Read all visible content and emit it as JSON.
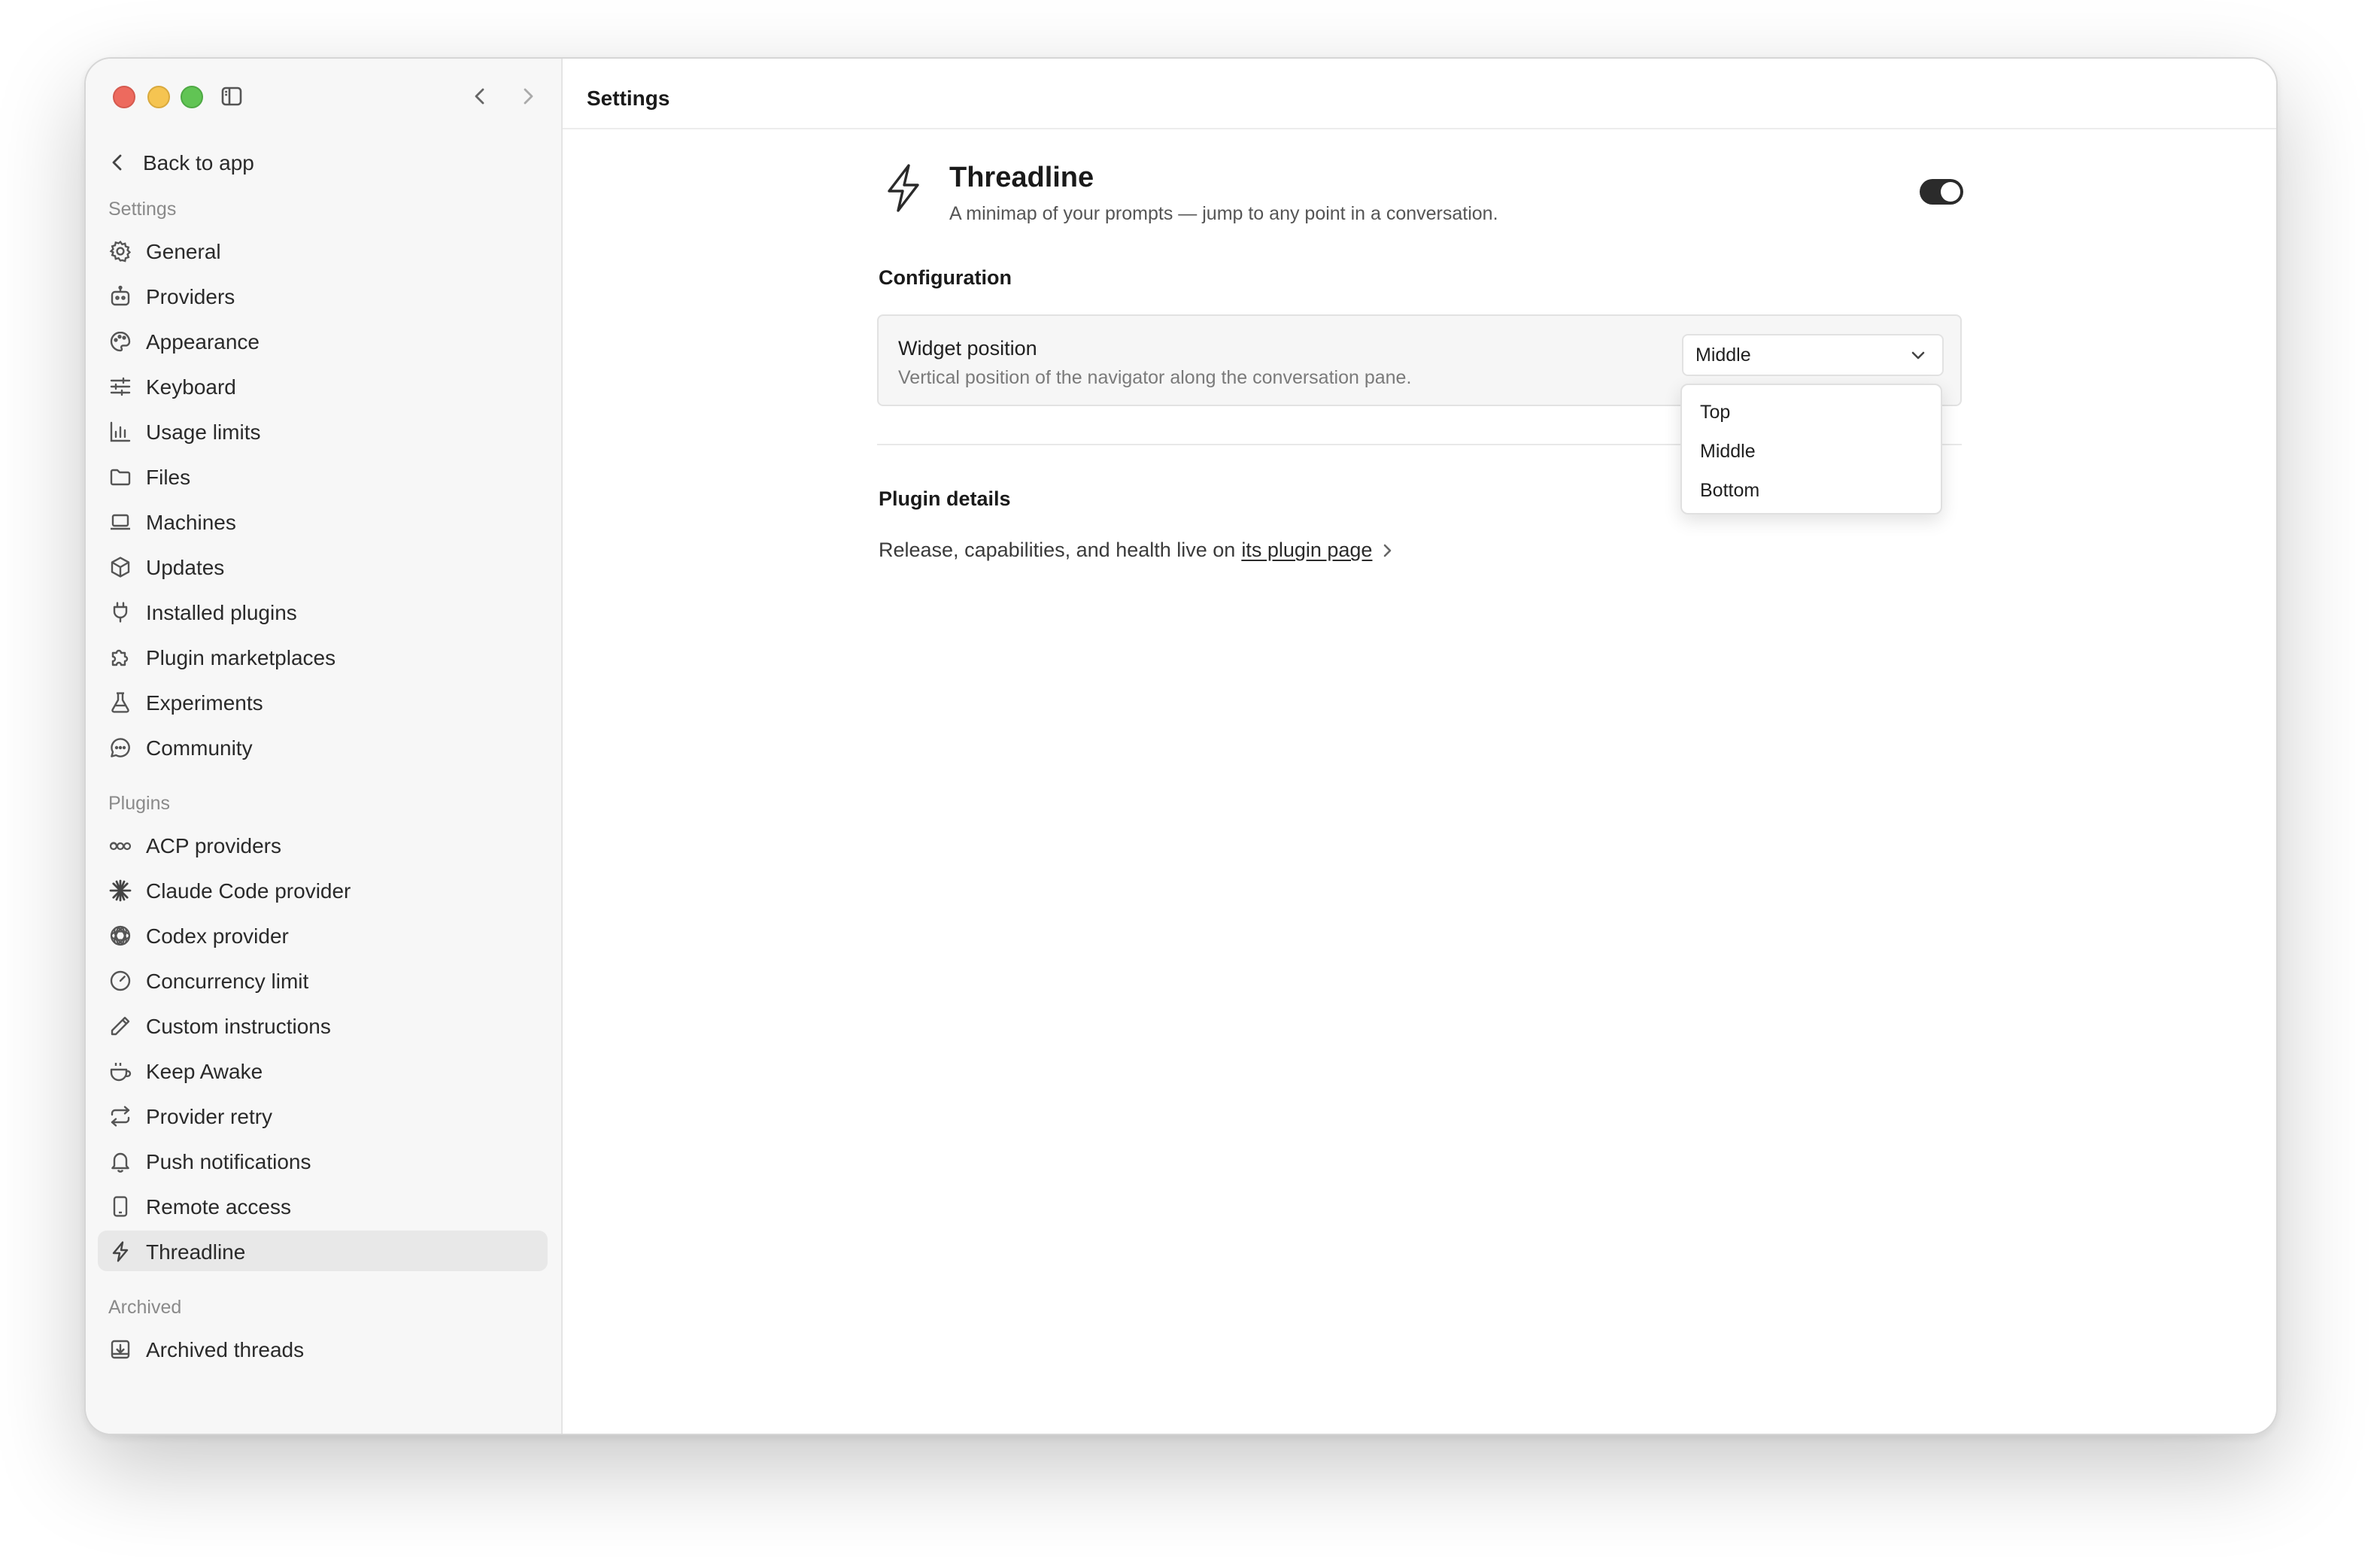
{
  "sidebar": {
    "back_label": "Back to app",
    "settings_heading": "Settings",
    "settings_items": [
      {
        "label": "General",
        "icon": "gear-icon"
      },
      {
        "label": "Providers",
        "icon": "bot-icon"
      },
      {
        "label": "Appearance",
        "icon": "palette-icon"
      },
      {
        "label": "Keyboard",
        "icon": "sliders-icon"
      },
      {
        "label": "Usage limits",
        "icon": "bar-chart-icon"
      },
      {
        "label": "Files",
        "icon": "folder-icon"
      },
      {
        "label": "Machines",
        "icon": "laptop-icon"
      },
      {
        "label": "Updates",
        "icon": "package-icon"
      },
      {
        "label": "Installed plugins",
        "icon": "plug-icon"
      },
      {
        "label": "Plugin marketplaces",
        "icon": "puzzle-icon"
      },
      {
        "label": "Experiments",
        "icon": "flask-icon"
      },
      {
        "label": "Community",
        "icon": "chat-bubble-icon"
      }
    ],
    "plugins_heading": "Plugins",
    "plugin_items": [
      {
        "label": "ACP providers",
        "icon": "acp-icon"
      },
      {
        "label": "Claude Code provider",
        "icon": "starburst-icon"
      },
      {
        "label": "Codex provider",
        "icon": "openai-icon"
      },
      {
        "label": "Concurrency limit",
        "icon": "gauge-icon"
      },
      {
        "label": "Custom instructions",
        "icon": "pencil-icon"
      },
      {
        "label": "Keep Awake",
        "icon": "coffee-icon"
      },
      {
        "label": "Provider retry",
        "icon": "repeat-icon"
      },
      {
        "label": "Push notifications",
        "icon": "bell-icon"
      },
      {
        "label": "Remote access",
        "icon": "phone-icon"
      },
      {
        "label": "Threadline",
        "icon": "lightning-icon"
      }
    ],
    "active_item": "Threadline",
    "archived_heading": "Archived",
    "archived_items": [
      {
        "label": "Archived threads",
        "icon": "archive-icon"
      }
    ]
  },
  "header": {
    "title": "Settings"
  },
  "plugin": {
    "name": "Threadline",
    "description": "A minimap of your prompts — jump to any point in a conversation.",
    "icon": "lightning-icon",
    "enabled": true
  },
  "configuration": {
    "heading": "Configuration",
    "widget_position": {
      "label": "Widget position",
      "description": "Vertical position of the navigator along the conversation pane.",
      "selected": "Middle",
      "options": [
        "Top",
        "Middle",
        "Bottom"
      ]
    }
  },
  "details": {
    "heading": "Plugin details",
    "text": "Release, capabilities, and health live on",
    "link_text": "its plugin page"
  },
  "colors": {
    "close": "#ed6a5e",
    "minimize": "#f5c451",
    "maximize": "#61c454",
    "toggle_on": "#2b2b2b",
    "active_nav": "#e8e8e8"
  }
}
